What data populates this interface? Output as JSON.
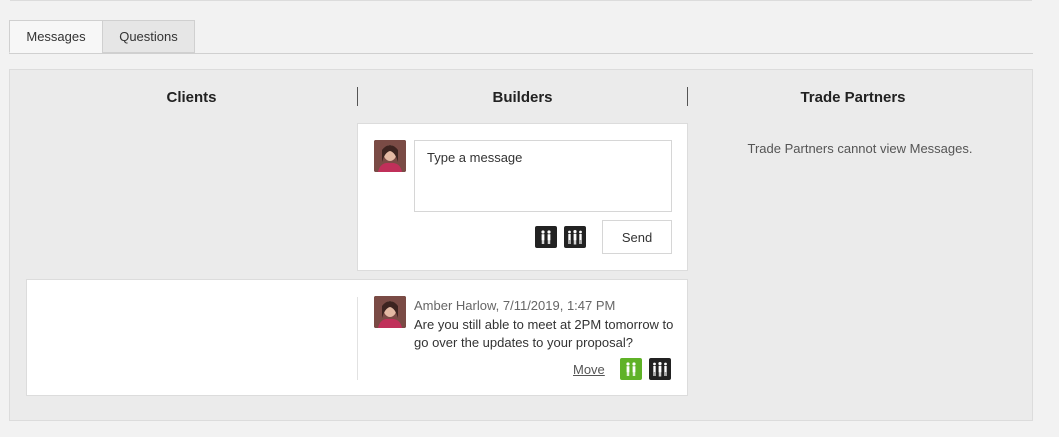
{
  "tabs": [
    {
      "label": "Messages"
    },
    {
      "label": "Questions"
    }
  ],
  "columns": {
    "clients": "Clients",
    "builders": "Builders",
    "trade_partners": "Trade Partners"
  },
  "composer": {
    "placeholder": "Type a message",
    "send_label": "Send",
    "icons": [
      "clients-visibility-icon",
      "all-parties-visibility-icon"
    ]
  },
  "trade_partners_note": "Trade Partners cannot view Messages.",
  "message": {
    "meta": "Amber Harlow, 7/11/2019, 1:47 PM",
    "text": "Are you still able to meet at 2PM tomorrow to go over the updates to your proposal?",
    "move_label": "Move",
    "icons": [
      "clients-visibility-icon",
      "all-parties-visibility-icon"
    ]
  },
  "colors": {
    "green_active": "#5fb227",
    "dark_icon": "#222222"
  }
}
